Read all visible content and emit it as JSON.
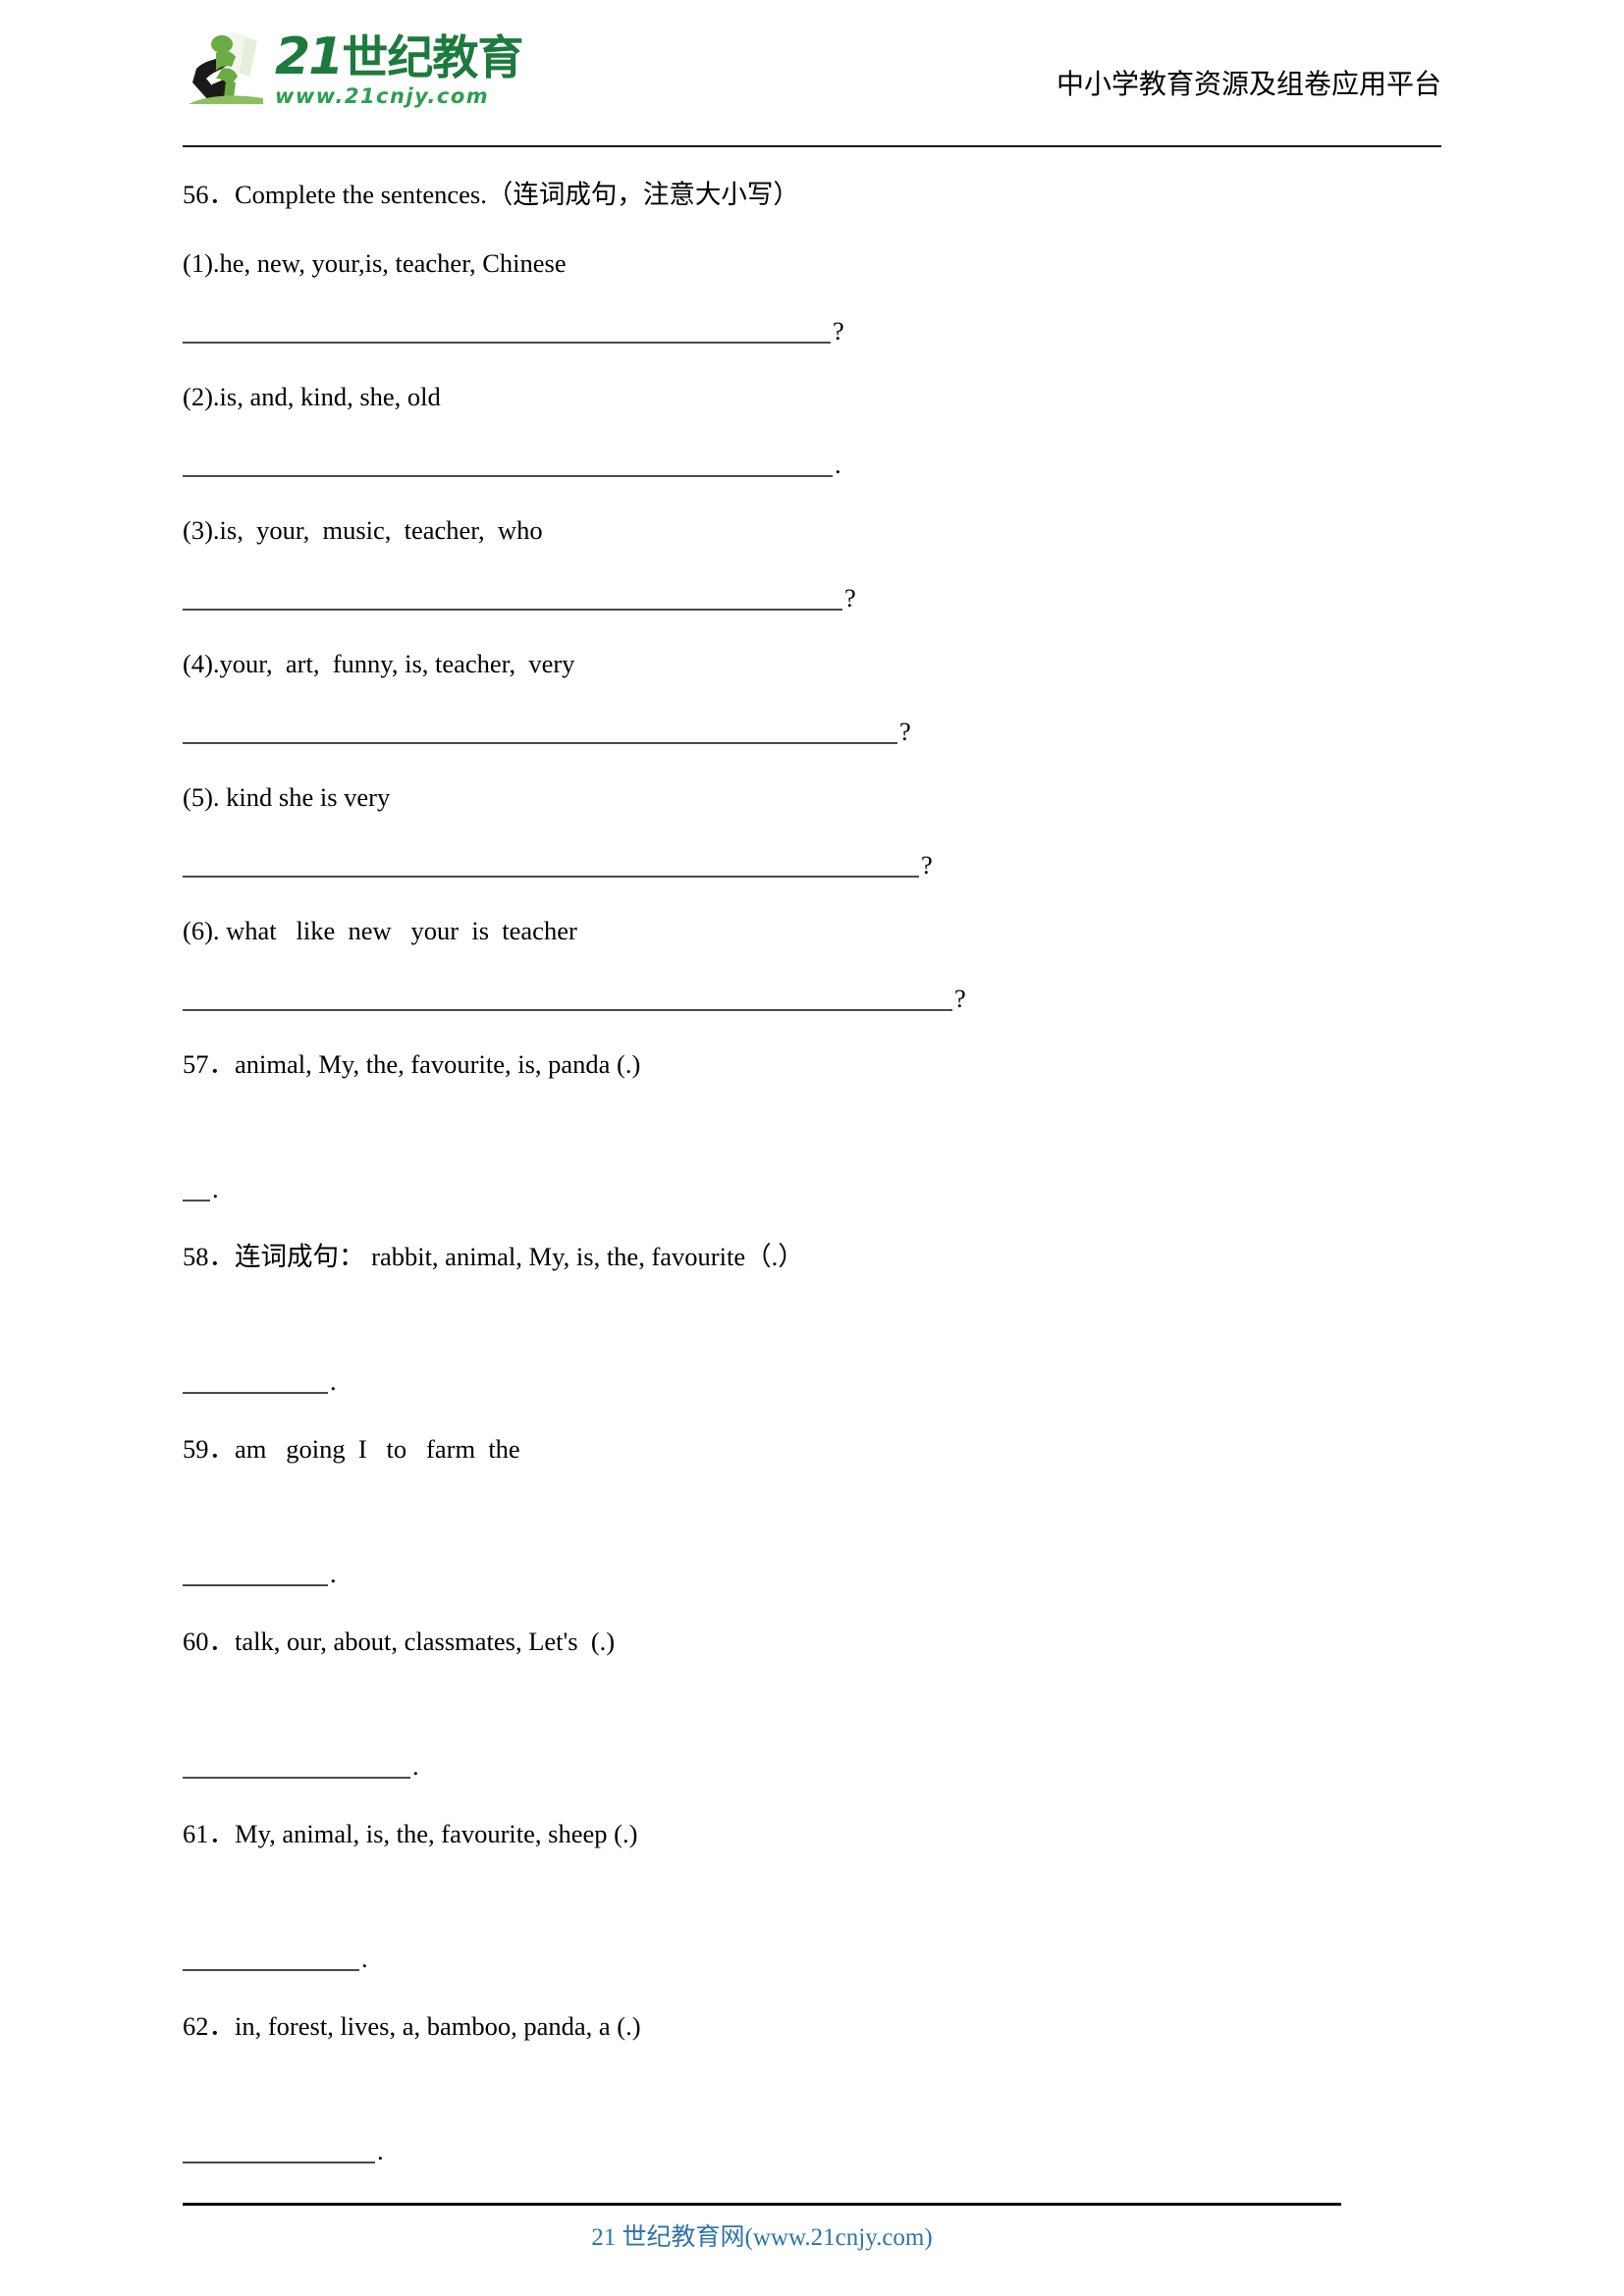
{
  "header": {
    "logo_title_number": "21",
    "logo_title_cn": "世纪教育",
    "logo_url": "www.21cnjy.com",
    "platform_title": "中小学教育资源及组卷应用平台",
    "logo_icon": "running-person-with-book-icon",
    "brand_color": "#1d7a3d"
  },
  "questions": [
    {
      "number": "56．",
      "prompt": "Complete the sentences.（连词成句，注意大小写）",
      "items": [
        {
          "label": "(1).he, new, your,is, teacher, Chinese",
          "rule_width": 660,
          "punct": "?"
        },
        {
          "label": "(2).is, and, kind, she, old",
          "rule_width": 662,
          "punct": "."
        },
        {
          "label": "(3).is,  your,  music,  teacher,  who",
          "rule_width": 672,
          "punct": "?"
        },
        {
          "label": "(4).your,  art,  funny, is, teacher,  very",
          "rule_width": 728,
          "punct": "?"
        },
        {
          "label": "(5). kind she is very",
          "rule_width": 750,
          "punct": "?"
        },
        {
          "label": "(6). what   like  new   your  is  teacher",
          "rule_width": 784,
          "punct": "?"
        }
      ]
    },
    {
      "number": "57．",
      "prompt": "animal, My, the, favourite, is, panda (.)",
      "rule_width": 28,
      "punct": "."
    },
    {
      "number": "58．",
      "prompt": "连词成句： rabbit, animal, My, is, the, favourite（.）",
      "rule_width": 148,
      "punct": "."
    },
    {
      "number": "59．",
      "prompt": "am   going  I   to   farm  the",
      "rule_width": 148,
      "punct": "."
    },
    {
      "number": "60．",
      "prompt": "talk, our, about, classmates, Let's  (.)",
      "rule_width": 232,
      "punct": "."
    },
    {
      "number": "61．",
      "prompt": "My, animal, is, the, favourite, sheep (.)",
      "rule_width": 180,
      "punct": "."
    },
    {
      "number": "62．",
      "prompt": "in, forest, lives, a, bamboo, panda, a (.)",
      "rule_width": 196,
      "punct": "."
    }
  ],
  "footer": {
    "text": "21 世纪教育网(www.21cnjy.com)",
    "link_color": "#2e74a8"
  }
}
